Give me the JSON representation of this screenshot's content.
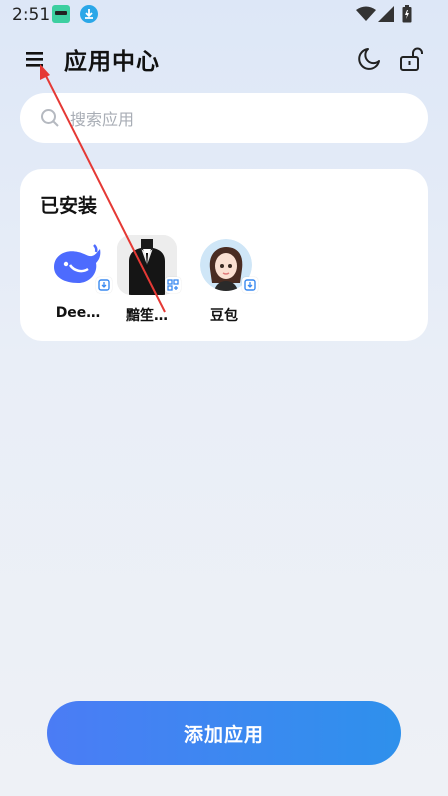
{
  "status_bar": {
    "time": "2:51",
    "icons": [
      "app-notification-icon",
      "download-icon",
      "wifi-icon",
      "signal-icon",
      "battery-icon"
    ]
  },
  "header": {
    "title": "应用中心",
    "menu_icon": "menu-icon",
    "theme_icon": "moon-icon",
    "lock_icon": "unlock-icon"
  },
  "search": {
    "placeholder": "搜索应用",
    "value": ""
  },
  "installed": {
    "title": "已安装",
    "apps": [
      {
        "label": "Dee…",
        "icon": "deepseek-whale-icon",
        "badge": "install-badge-icon"
      },
      {
        "label": "黯笙…",
        "icon": "suit-avatar-icon",
        "badge": "clone-badge-icon"
      },
      {
        "label": "豆包",
        "icon": "doubao-avatar-icon",
        "badge": "install-badge-icon"
      }
    ]
  },
  "add_button": {
    "label": "添加应用"
  },
  "colors": {
    "accent": "#3a8af0",
    "annotation": "#e53935",
    "card": "#ffffff"
  }
}
